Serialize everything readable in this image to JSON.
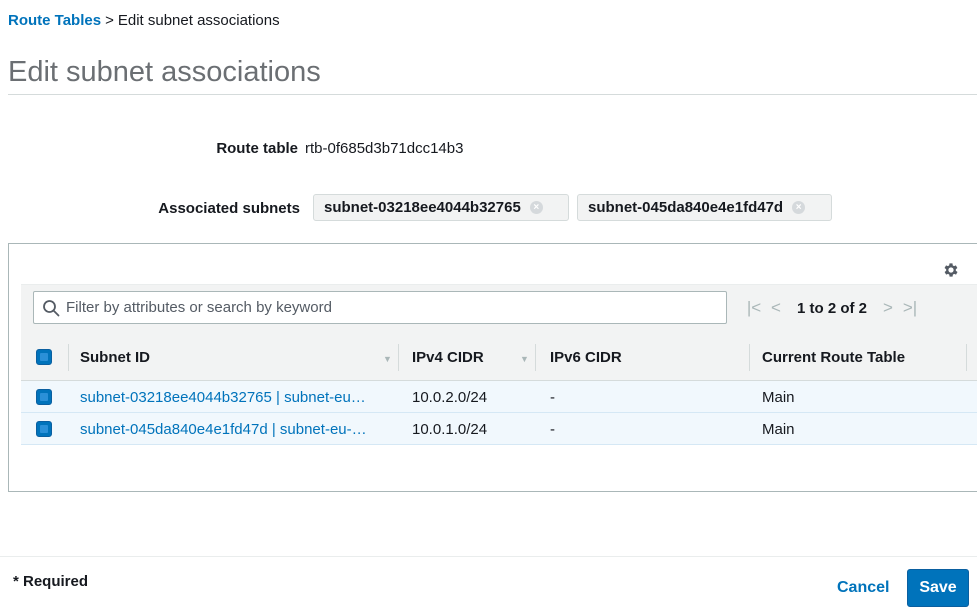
{
  "breadcrumb": {
    "parent": "Route Tables",
    "separator": ">",
    "current": "Edit subnet associations"
  },
  "page": {
    "title": "Edit subnet associations"
  },
  "form": {
    "route_table_label": "Route table",
    "route_table_value": "rtb-0f685d3b71dcc14b3",
    "associated_label": "Associated subnets",
    "tokens": [
      "subnet-03218ee4044b32765",
      "subnet-045da840e4e1fd47d"
    ]
  },
  "table": {
    "search_placeholder": "Filter by attributes or search by keyword",
    "pagination": "1 to 2 of 2",
    "columns": [
      "Subnet ID",
      "IPv4 CIDR",
      "IPv6 CIDR",
      "Current Route Table"
    ],
    "rows": [
      {
        "subnet": "subnet-03218ee4044b32765 | subnet-eu…",
        "ipv4": "10.0.2.0/24",
        "ipv6": "-",
        "route_table": "Main",
        "selected": true
      },
      {
        "subnet": "subnet-045da840e4e1fd47d | subnet-eu-…",
        "ipv4": "10.0.1.0/24",
        "ipv6": "-",
        "route_table": "Main",
        "selected": true
      }
    ]
  },
  "footer": {
    "required": "* Required",
    "cancel": "Cancel",
    "save": "Save"
  },
  "colors": {
    "link": "#0073bb",
    "primary": "#0073bb",
    "selected_row": "#f1f8fd"
  },
  "icons": {
    "search": "search-icon",
    "settings": "gear-icon",
    "token_remove": "close-icon"
  }
}
